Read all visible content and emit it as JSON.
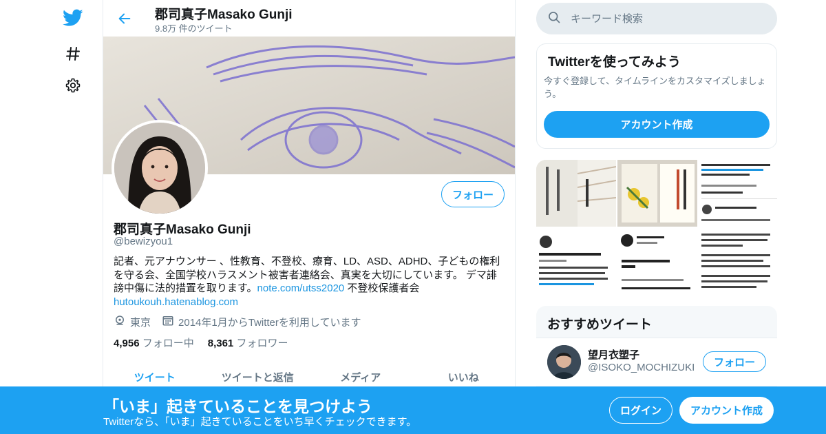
{
  "colors": {
    "accent": "#1da1f2",
    "text": "#14171a",
    "muted": "#657786",
    "border": "#e6ecf0"
  },
  "nav": {
    "icons": [
      "twitter-bird-icon",
      "hashtag-icon",
      "gear-icon"
    ]
  },
  "header": {
    "name": "郡司真子Masako Gunji",
    "tweet_count": "9.8万 件のツイート"
  },
  "profile": {
    "follow_label": "フォロー",
    "name": "郡司真子Masako Gunji",
    "handle": "@bewizyou1",
    "bio_text": "記者、元アナウンサー 、性教育、不登校、療育、LD、ASD、ADHD、子どもの権利を守る会、全国学校ハラスメント被害者連絡会、真実を大切にしています。 デマ誹謗中傷に法的措置を取ります。",
    "bio_link1": "note.com/utss2020",
    "bio_after_link": " 不登校保護者会",
    "bio_link2": "hutoukouh.hatenablog.com",
    "location": "東京",
    "joined": "2014年1月からTwitterを利用しています",
    "following_count": "4,956",
    "following_label": "フォロー中",
    "followers_count": "8,361",
    "followers_label": "フォロワー"
  },
  "tabs": [
    "ツイート",
    "ツイートと返信",
    "メディア",
    "いいね"
  ],
  "search": {
    "placeholder": "キーワード検索"
  },
  "signup_card": {
    "title": "Twitterを使ってみよう",
    "text": "今すぐ登録して、タイムラインをカスタマイズしましょう。",
    "button": "アカウント作成"
  },
  "recommended": {
    "title": "おすすめツイート",
    "items": [
      {
        "name": "望月衣塑子",
        "handle": "@ISOKO_MOCHIZUKI",
        "follow": "フォロー"
      }
    ]
  },
  "bottombar": {
    "title": "「いま」起きていることを見つけよう",
    "subtitle": "Twitterなら、「いま」起きていることをいち早くチェックできます。",
    "login": "ログイン",
    "signup": "アカウント作成"
  }
}
